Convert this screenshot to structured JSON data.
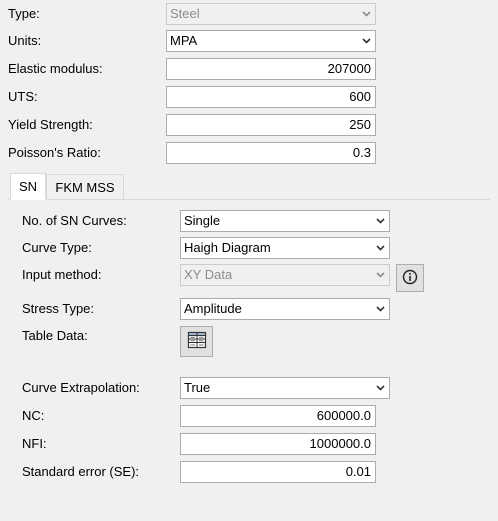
{
  "material": {
    "type_label": "Type:",
    "type_value": "Steel",
    "units_label": "Units:",
    "units_value": "MPA",
    "elastic_label": "Elastic modulus:",
    "elastic_value": "207000",
    "uts_label": "UTS:",
    "uts_value": "600",
    "yield_label": "Yield Strength:",
    "yield_value": "250",
    "poisson_label": "Poisson's Ratio:",
    "poisson_value": "0.3"
  },
  "tabs": [
    {
      "label": "SN",
      "active": true
    },
    {
      "label": "FKM MSS",
      "active": false
    }
  ],
  "sn": {
    "curves_label": "No. of SN Curves:",
    "curves_value": "Single",
    "curve_type_label": "Curve Type:",
    "curve_type_value": "Haigh Diagram",
    "input_method_label": "Input method:",
    "input_method_value": "XY Data",
    "stress_type_label": "Stress Type:",
    "stress_type_value": "Amplitude",
    "table_data_label": "Table Data:",
    "extrapolation_label": "Curve Extrapolation:",
    "extrapolation_value": "True",
    "nc_label": "NC:",
    "nc_value": "600000.0",
    "nfi_label": "NFI:",
    "nfi_value": "1000000.0",
    "se_label": "Standard error (SE):",
    "se_value": "0.01"
  },
  "icons": {
    "dropdown": "chevron-down-icon",
    "info": "info-icon",
    "table": "table-icon"
  },
  "colors": {
    "background": "#f0f0f0",
    "disabled_text": "#8c8c8c",
    "border": "#acacac"
  }
}
